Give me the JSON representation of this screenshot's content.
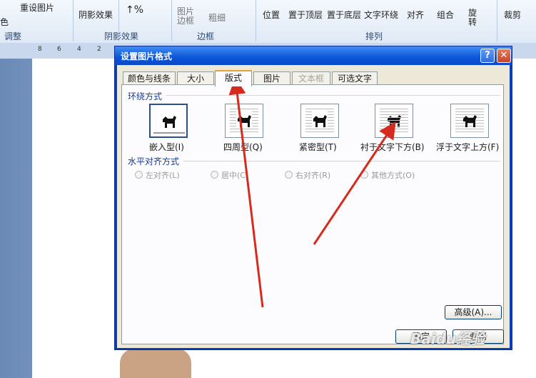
{
  "ribbon": {
    "reset_picture": "重设图片",
    "left_partial": "色",
    "shadow_effect": "阴影效果",
    "picture_border": "图片\n边框",
    "thickness": "粗细",
    "position": "位置",
    "bring_front": "置于顶层",
    "send_back": "置于底层",
    "text_wrap": "文字环绕",
    "align": "对齐",
    "group": "组合",
    "rotate": "旋\n转",
    "crop": "裁剪",
    "group_adjust": "调整",
    "group_shadow": "阴影效果",
    "group_border": "边框",
    "group_arrange": "排列"
  },
  "ruler": {
    "numbers": [
      "8",
      "6",
      "4",
      "2"
    ]
  },
  "dialog": {
    "title": "设置图片格式",
    "help": "?",
    "close": "✕",
    "tabs": [
      {
        "label": "颜色与线条"
      },
      {
        "label": "大小"
      },
      {
        "label": "版式",
        "active": true
      },
      {
        "label": "图片"
      },
      {
        "label": "文本框",
        "disabled": true
      },
      {
        "label": "可选文字"
      }
    ],
    "wrap_section": "环绕方式",
    "wrap_options": [
      {
        "label": "嵌入型(I)",
        "selected": true
      },
      {
        "label": "四周型(Q)"
      },
      {
        "label": "紧密型(T)"
      },
      {
        "label": "衬于文字下方(B)"
      },
      {
        "label": "浮于文字上方(F)"
      }
    ],
    "align_section": "水平对齐方式",
    "align_options": [
      "左对齐(L)",
      "居中(C)",
      "右对齐(R)",
      "其他方式(O)"
    ],
    "advanced": "高级(A)...",
    "ok": "确定",
    "cancel": "取消"
  },
  "watermark": "Baidu经验",
  "colors": {
    "title_bar": "#0b55d8",
    "arrow": "#d62a1e",
    "tab_highlight": "#e6a23a"
  }
}
